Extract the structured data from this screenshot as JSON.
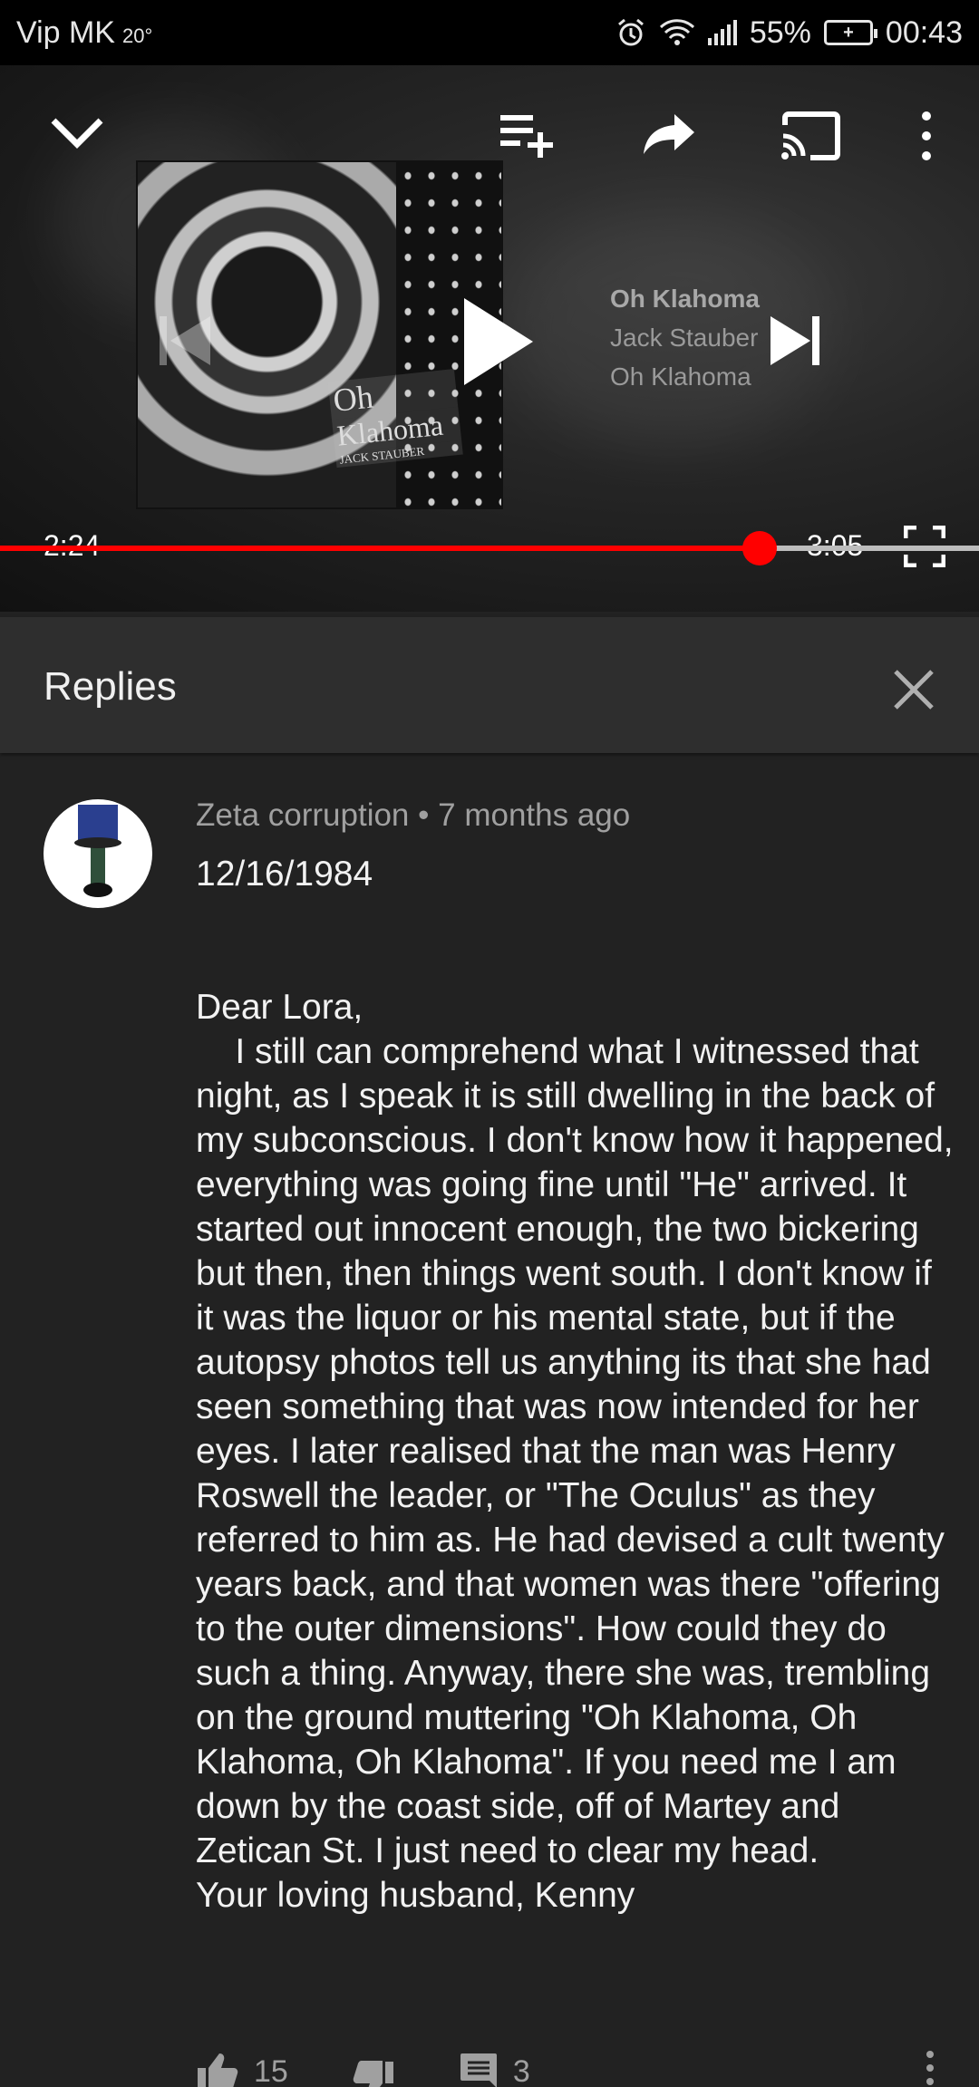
{
  "status_bar": {
    "carrier": "Vip MK",
    "temperature": "20°",
    "battery": "55%",
    "time": "00:43"
  },
  "player": {
    "track_title": "Oh Klahoma",
    "artist": "Jack Stauber",
    "album": "Oh Klahoma",
    "album_art_text_1": "Oh",
    "album_art_text_2": "Klahoma",
    "album_art_text_3": "JACK STAUBER",
    "current_time": "2:24",
    "duration": "3:05",
    "progress_fraction": 0.776,
    "icons": [
      "chevron-down-icon",
      "add-to-queue-icon",
      "share-icon",
      "cast-icon",
      "more-vert-icon",
      "previous-icon",
      "play-icon",
      "next-icon",
      "fullscreen-icon"
    ]
  },
  "replies": {
    "title": "Replies",
    "close_icon": "close-icon"
  },
  "comment": {
    "author": "Zeta corruption",
    "separator": "•",
    "age": "7 months ago",
    "avatar_text": "Zeta corruption",
    "body": "12/16/1984\n\n\nDear Lora,\n    I still can comprehend what I witnessed that night, as I speak it is still dwelling in the back of my subconscious. I don't know how it happened, everything was going fine until \"He\" arrived. It started out innocent enough, the two bickering but then, then things went south. I don't know if it was the liquor or his mental state, but if the autopsy photos tell us anything its that she had seen something that was now intended for her eyes. I later realised that the man was Henry Roswell the leader, or \"The Oculus\" as they referred to him as. He had devised a cult twenty years back, and that women was there \"offering to the outer dimensions\". How could they do such a thing. Anyway, there she was, trembling on the ground muttering \"Oh Klahoma, Oh Klahoma, Oh Klahoma\". If you need me I am down by the coast side, off of Martey and Zetican St. I just need to clear my head.\nYour loving husband, Kenny",
    "likes": "15",
    "reply_count": "3"
  },
  "colors": {
    "accent": "#ff0000",
    "background": "#222222",
    "header_bg": "#2e2e2e",
    "secondary_text": "#a0a0a0"
  }
}
